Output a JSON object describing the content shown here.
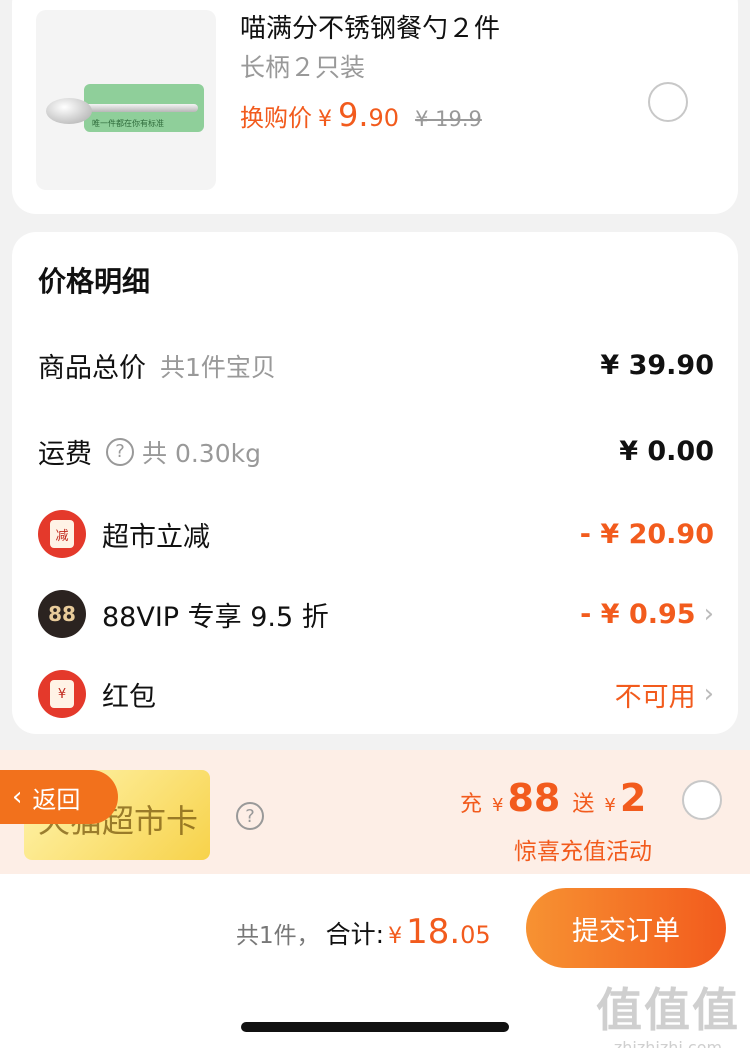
{
  "product": {
    "title": "喵满分不锈钢餐勺２件",
    "subtitle": "长柄２只装",
    "price_label": "换购价",
    "currency": "¥",
    "price_int": "9.",
    "price_dec": "90",
    "orig_price": "¥ 19.9",
    "pack_text": "唯一件都在你有标准"
  },
  "detail": {
    "title": "价格明细",
    "goods_total_label": "商品总价",
    "goods_total_note": "共1件宝贝",
    "goods_total_value": "¥ 39.90",
    "shipping_label": "运费",
    "shipping_note": "共 0.30kg",
    "shipping_value": "¥ 0.00",
    "market_discount_icon": "减",
    "market_discount_label": "超市立减",
    "market_discount_value": "- ¥ 20.90",
    "vip_icon": "88",
    "vip_label": "88VIP 专享 9.5 折",
    "vip_value": "- ¥ 0.95",
    "redpacket_icon": "¥",
    "redpacket_label": "红包",
    "redpacket_value": "不可用",
    "help_glyph": "?",
    "chevron_glyph": "›"
  },
  "promo": {
    "card_name": "天猫超市卡",
    "recharge_label": "充",
    "recharge_cur": "¥",
    "recharge_amount": "88",
    "gift_label": "送",
    "gift_cur": "¥",
    "gift_amount": "2",
    "caption": "惊喜充值活动",
    "help_glyph": "?"
  },
  "back": {
    "glyph": "‹",
    "label": "返回"
  },
  "footer": {
    "count_text": "共1件，",
    "total_label": "合计:",
    "currency": "¥",
    "total_int": "18.",
    "total_dec": "05",
    "submit_label": "提交订单"
  },
  "watermark": {
    "logo": "值值值",
    "url": "zhizhizhi.com"
  }
}
